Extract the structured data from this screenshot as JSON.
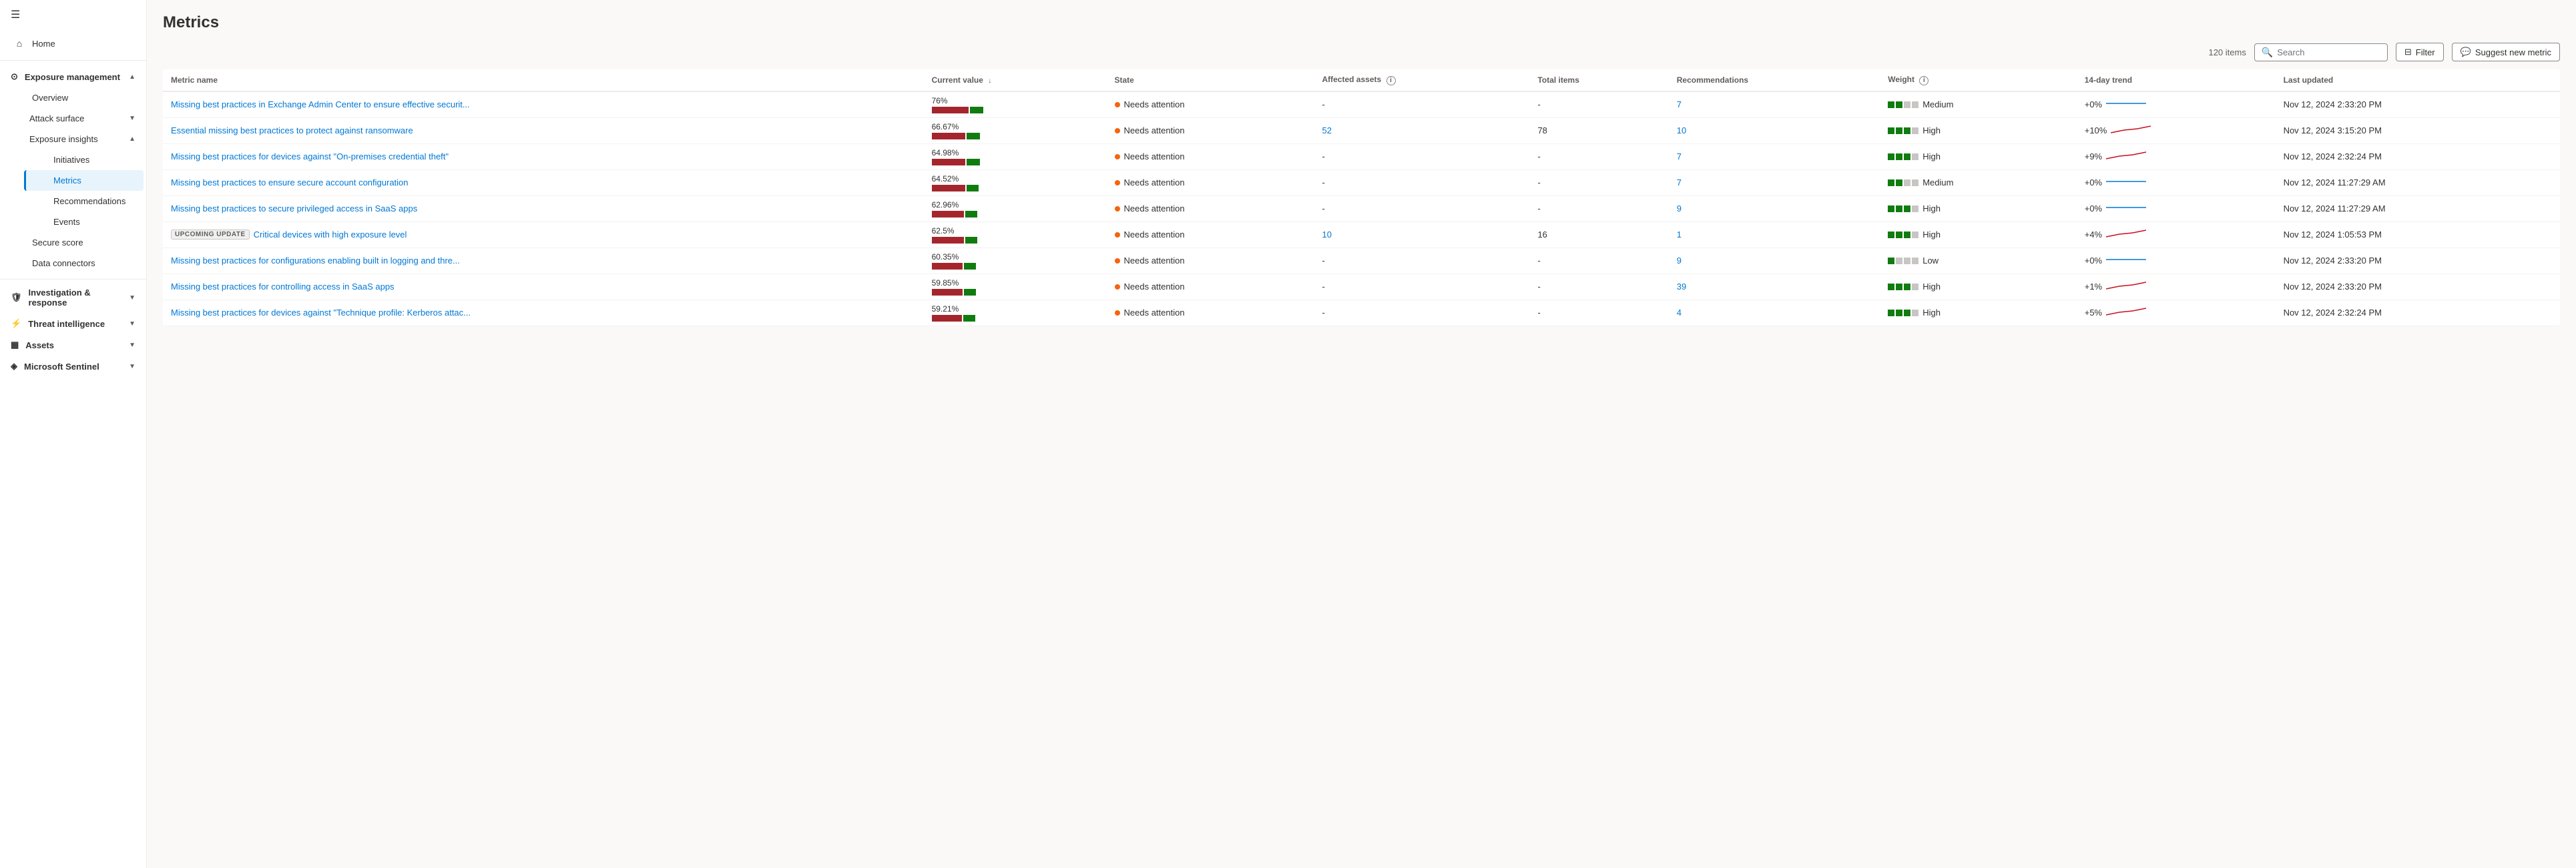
{
  "sidebar": {
    "hamburger": "☰",
    "home_label": "Home",
    "exposure_management_label": "Exposure management",
    "overview_label": "Overview",
    "attack_surface_label": "Attack surface",
    "exposure_insights_label": "Exposure insights",
    "initiatives_label": "Initiatives",
    "metrics_label": "Metrics",
    "recommendations_label": "Recommendations",
    "events_label": "Events",
    "secure_score_label": "Secure score",
    "data_connectors_label": "Data connectors",
    "investigation_response_label": "Investigation & response",
    "threat_intelligence_label": "Threat intelligence",
    "assets_label": "Assets",
    "microsoft_sentinel_label": "Microsoft Sentinel"
  },
  "page": {
    "title": "Metrics",
    "item_count": "120 items"
  },
  "toolbar": {
    "search_placeholder": "Search",
    "filter_label": "Filter",
    "suggest_label": "Suggest new metric"
  },
  "table": {
    "headers": {
      "metric_name": "Metric name",
      "current_value": "Current value",
      "state": "State",
      "affected_assets": "Affected assets",
      "total_items": "Total items",
      "recommendations": "Recommendations",
      "weight": "Weight",
      "trend_14day": "14-day trend",
      "last_updated": "Last updated"
    },
    "rows": [
      {
        "name": "Missing best practices in Exchange Admin Center to ensure effective securit...",
        "current_value": "76%",
        "red_width": 55,
        "green_width": 20,
        "state": "Needs attention",
        "affected_assets": "-",
        "total_items": "-",
        "recommendations": "7",
        "weight": "Medium",
        "weight_filled": 2,
        "weight_total": 4,
        "trend": "+0%",
        "trend_type": "flat",
        "last_updated": "Nov 12, 2024 2:33:20 PM",
        "upcoming": false
      },
      {
        "name": "Essential missing best practices to protect against ransomware",
        "current_value": "66.67%",
        "red_width": 50,
        "green_width": 20,
        "state": "Needs attention",
        "affected_assets": "52",
        "total_items": "78",
        "recommendations": "10",
        "weight": "High",
        "weight_filled": 3,
        "weight_total": 4,
        "trend": "+10%",
        "trend_type": "up",
        "last_updated": "Nov 12, 2024 3:15:20 PM",
        "upcoming": false
      },
      {
        "name": "Missing best practices for devices against \"On-premises credential theft\"",
        "current_value": "64.98%",
        "red_width": 50,
        "green_width": 20,
        "state": "Needs attention",
        "affected_assets": "-",
        "total_items": "-",
        "recommendations": "7",
        "weight": "High",
        "weight_filled": 3,
        "weight_total": 4,
        "trend": "+9%",
        "trend_type": "up",
        "last_updated": "Nov 12, 2024 2:32:24 PM",
        "upcoming": false
      },
      {
        "name": "Missing best practices to ensure secure account configuration",
        "current_value": "64.52%",
        "red_width": 50,
        "green_width": 18,
        "state": "Needs attention",
        "affected_assets": "-",
        "total_items": "-",
        "recommendations": "7",
        "weight": "Medium",
        "weight_filled": 2,
        "weight_total": 4,
        "trend": "+0%",
        "trend_type": "flat",
        "last_updated": "Nov 12, 2024 11:27:29 AM",
        "upcoming": false
      },
      {
        "name": "Missing best practices to secure privileged access in SaaS apps",
        "current_value": "62.96%",
        "red_width": 48,
        "green_width": 18,
        "state": "Needs attention",
        "affected_assets": "-",
        "total_items": "-",
        "recommendations": "9",
        "weight": "High",
        "weight_filled": 3,
        "weight_total": 4,
        "trend": "+0%",
        "trend_type": "flat",
        "last_updated": "Nov 12, 2024 11:27:29 AM",
        "upcoming": false
      },
      {
        "name": "Critical devices with high exposure level",
        "current_value": "62.5%",
        "red_width": 48,
        "green_width": 18,
        "state": "Needs attention",
        "affected_assets": "10",
        "total_items": "16",
        "recommendations": "1",
        "weight": "High",
        "weight_filled": 3,
        "weight_total": 4,
        "trend": "+4%",
        "trend_type": "up",
        "last_updated": "Nov 12, 2024 1:05:53 PM",
        "upcoming": true
      },
      {
        "name": "Missing best practices for configurations enabling built in logging and thre...",
        "current_value": "60.35%",
        "red_width": 46,
        "green_width": 18,
        "state": "Needs attention",
        "affected_assets": "-",
        "total_items": "-",
        "recommendations": "9",
        "weight": "Low",
        "weight_filled": 1,
        "weight_total": 4,
        "trend": "+0%",
        "trend_type": "flat",
        "last_updated": "Nov 12, 2024 2:33:20 PM",
        "upcoming": false
      },
      {
        "name": "Missing best practices for controlling access in SaaS apps",
        "current_value": "59.85%",
        "red_width": 46,
        "green_width": 18,
        "state": "Needs attention",
        "affected_assets": "-",
        "total_items": "-",
        "recommendations": "39",
        "weight": "High",
        "weight_filled": 3,
        "weight_total": 4,
        "trend": "+1%",
        "trend_type": "up",
        "last_updated": "Nov 12, 2024 2:33:20 PM",
        "upcoming": false
      },
      {
        "name": "Missing best practices for devices against \"Technique profile: Kerberos attac...",
        "current_value": "59.21%",
        "red_width": 45,
        "green_width": 18,
        "state": "Needs attention",
        "affected_assets": "-",
        "total_items": "-",
        "recommendations": "4",
        "weight": "High",
        "weight_filled": 3,
        "weight_total": 4,
        "trend": "+5%",
        "trend_type": "up",
        "last_updated": "Nov 12, 2024 2:32:24 PM",
        "upcoming": false
      }
    ]
  }
}
